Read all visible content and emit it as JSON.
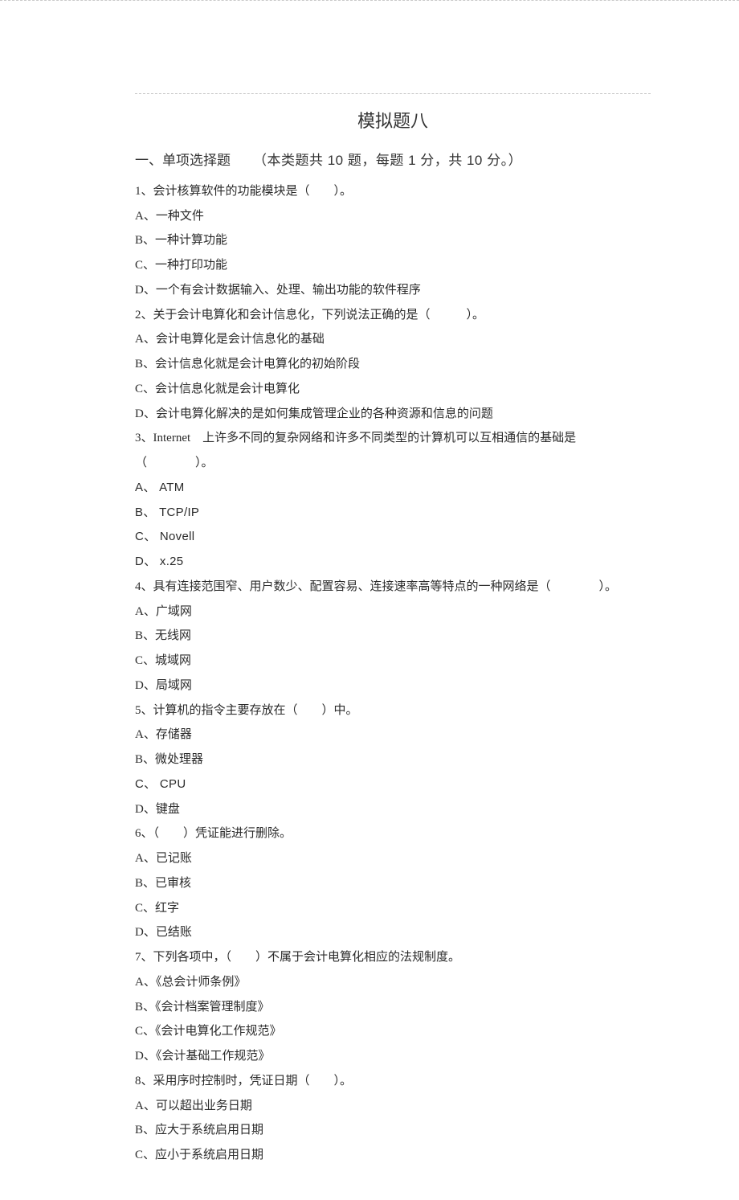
{
  "title": "模拟题八",
  "section": {
    "heading": "一、单项选择题",
    "info": "（本类题共 10 题，每题 1 分，共 10 分。）"
  },
  "questions": [
    {
      "stem": "1、会计核算软件的功能模块是（　　）。",
      "options": [
        "A、一种文件",
        "B、一种计算功能",
        "C、一种打印功能",
        "D、一个有会计数据输入、处理、输出功能的软件程序"
      ]
    },
    {
      "stem": "2、关于会计电算化和会计信息化，下列说法正确的是（　　　）。",
      "options": [
        "A、会计电算化是会计信息化的基础",
        "B、会计信息化就是会计电算化的初始阶段",
        "C、会计信息化就是会计电算化",
        "D、会计电算化解决的是如何集成管理企业的各种资源和信息的问题"
      ]
    },
    {
      "stem": "3、Internet　上许多不同的复杂网络和许多不同类型的计算机可以互相通信的基础是（　　　　）。",
      "options": [
        "A、 ATM",
        "B、 TCP/IP",
        "C、 Novell",
        "D、 x.25"
      ]
    },
    {
      "stem": "4、具有连接范围窄、用户数少、配置容易、连接速率高等特点的一种网络是（　　　　）。",
      "options": [
        "A、广域网",
        "B、无线网",
        "C、城域网",
        "D、局域网"
      ]
    },
    {
      "stem": "5、计算机的指令主要存放在（　　）中。",
      "options": [
        "A、存储器",
        "B、微处理器",
        "C、 CPU",
        "D、键盘"
      ]
    },
    {
      "stem": "6、（　　）凭证能进行删除。",
      "options": [
        "A、已记账",
        "B、已审核",
        "C、红字",
        "D、已结账"
      ]
    },
    {
      "stem": "7、下列各项中，（　　）不属于会计电算化相应的法规制度。",
      "options": [
        "A、《总会计师条例》",
        "B、《会计档案管理制度》",
        "C、《会计电算化工作规范》",
        "D、《会计基础工作规范》"
      ]
    },
    {
      "stem": "8、采用序时控制时，凭证日期（　　）。",
      "options": [
        "A、可以超出业务日期",
        "B、应大于系统启用日期",
        "C、应小于系统启用日期"
      ]
    }
  ]
}
